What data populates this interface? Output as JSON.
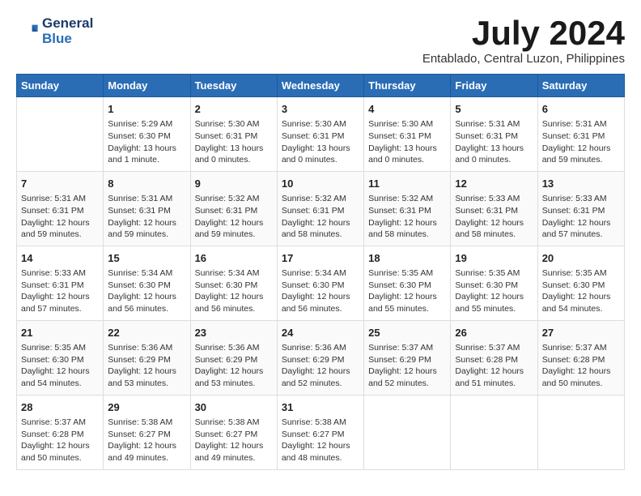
{
  "header": {
    "logo_line1": "General",
    "logo_line2": "Blue",
    "month": "July 2024",
    "location": "Entablado, Central Luzon, Philippines"
  },
  "days_of_week": [
    "Sunday",
    "Monday",
    "Tuesday",
    "Wednesday",
    "Thursday",
    "Friday",
    "Saturday"
  ],
  "weeks": [
    [
      {
        "day": "",
        "info": ""
      },
      {
        "day": "1",
        "info": "Sunrise: 5:29 AM\nSunset: 6:30 PM\nDaylight: 13 hours\nand 1 minute."
      },
      {
        "day": "2",
        "info": "Sunrise: 5:30 AM\nSunset: 6:31 PM\nDaylight: 13 hours\nand 0 minutes."
      },
      {
        "day": "3",
        "info": "Sunrise: 5:30 AM\nSunset: 6:31 PM\nDaylight: 13 hours\nand 0 minutes."
      },
      {
        "day": "4",
        "info": "Sunrise: 5:30 AM\nSunset: 6:31 PM\nDaylight: 13 hours\nand 0 minutes."
      },
      {
        "day": "5",
        "info": "Sunrise: 5:31 AM\nSunset: 6:31 PM\nDaylight: 13 hours\nand 0 minutes."
      },
      {
        "day": "6",
        "info": "Sunrise: 5:31 AM\nSunset: 6:31 PM\nDaylight: 12 hours\nand 59 minutes."
      }
    ],
    [
      {
        "day": "7",
        "info": "Sunrise: 5:31 AM\nSunset: 6:31 PM\nDaylight: 12 hours\nand 59 minutes."
      },
      {
        "day": "8",
        "info": "Sunrise: 5:31 AM\nSunset: 6:31 PM\nDaylight: 12 hours\nand 59 minutes."
      },
      {
        "day": "9",
        "info": "Sunrise: 5:32 AM\nSunset: 6:31 PM\nDaylight: 12 hours\nand 59 minutes."
      },
      {
        "day": "10",
        "info": "Sunrise: 5:32 AM\nSunset: 6:31 PM\nDaylight: 12 hours\nand 58 minutes."
      },
      {
        "day": "11",
        "info": "Sunrise: 5:32 AM\nSunset: 6:31 PM\nDaylight: 12 hours\nand 58 minutes."
      },
      {
        "day": "12",
        "info": "Sunrise: 5:33 AM\nSunset: 6:31 PM\nDaylight: 12 hours\nand 58 minutes."
      },
      {
        "day": "13",
        "info": "Sunrise: 5:33 AM\nSunset: 6:31 PM\nDaylight: 12 hours\nand 57 minutes."
      }
    ],
    [
      {
        "day": "14",
        "info": "Sunrise: 5:33 AM\nSunset: 6:31 PM\nDaylight: 12 hours\nand 57 minutes."
      },
      {
        "day": "15",
        "info": "Sunrise: 5:34 AM\nSunset: 6:30 PM\nDaylight: 12 hours\nand 56 minutes."
      },
      {
        "day": "16",
        "info": "Sunrise: 5:34 AM\nSunset: 6:30 PM\nDaylight: 12 hours\nand 56 minutes."
      },
      {
        "day": "17",
        "info": "Sunrise: 5:34 AM\nSunset: 6:30 PM\nDaylight: 12 hours\nand 56 minutes."
      },
      {
        "day": "18",
        "info": "Sunrise: 5:35 AM\nSunset: 6:30 PM\nDaylight: 12 hours\nand 55 minutes."
      },
      {
        "day": "19",
        "info": "Sunrise: 5:35 AM\nSunset: 6:30 PM\nDaylight: 12 hours\nand 55 minutes."
      },
      {
        "day": "20",
        "info": "Sunrise: 5:35 AM\nSunset: 6:30 PM\nDaylight: 12 hours\nand 54 minutes."
      }
    ],
    [
      {
        "day": "21",
        "info": "Sunrise: 5:35 AM\nSunset: 6:30 PM\nDaylight: 12 hours\nand 54 minutes."
      },
      {
        "day": "22",
        "info": "Sunrise: 5:36 AM\nSunset: 6:29 PM\nDaylight: 12 hours\nand 53 minutes."
      },
      {
        "day": "23",
        "info": "Sunrise: 5:36 AM\nSunset: 6:29 PM\nDaylight: 12 hours\nand 53 minutes."
      },
      {
        "day": "24",
        "info": "Sunrise: 5:36 AM\nSunset: 6:29 PM\nDaylight: 12 hours\nand 52 minutes."
      },
      {
        "day": "25",
        "info": "Sunrise: 5:37 AM\nSunset: 6:29 PM\nDaylight: 12 hours\nand 52 minutes."
      },
      {
        "day": "26",
        "info": "Sunrise: 5:37 AM\nSunset: 6:28 PM\nDaylight: 12 hours\nand 51 minutes."
      },
      {
        "day": "27",
        "info": "Sunrise: 5:37 AM\nSunset: 6:28 PM\nDaylight: 12 hours\nand 50 minutes."
      }
    ],
    [
      {
        "day": "28",
        "info": "Sunrise: 5:37 AM\nSunset: 6:28 PM\nDaylight: 12 hours\nand 50 minutes."
      },
      {
        "day": "29",
        "info": "Sunrise: 5:38 AM\nSunset: 6:27 PM\nDaylight: 12 hours\nand 49 minutes."
      },
      {
        "day": "30",
        "info": "Sunrise: 5:38 AM\nSunset: 6:27 PM\nDaylight: 12 hours\nand 49 minutes."
      },
      {
        "day": "31",
        "info": "Sunrise: 5:38 AM\nSunset: 6:27 PM\nDaylight: 12 hours\nand 48 minutes."
      },
      {
        "day": "",
        "info": ""
      },
      {
        "day": "",
        "info": ""
      },
      {
        "day": "",
        "info": ""
      }
    ]
  ]
}
